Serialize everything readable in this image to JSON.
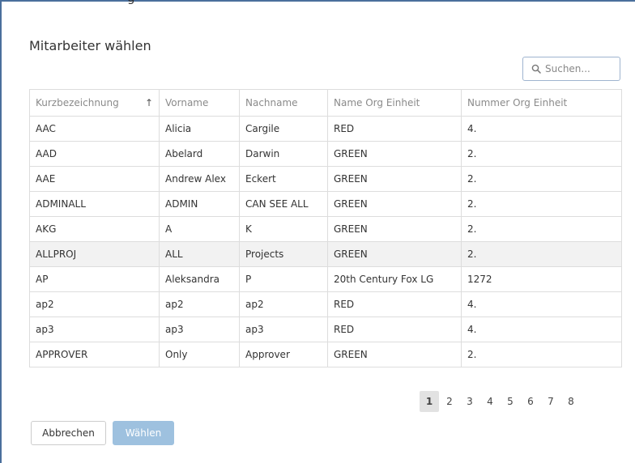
{
  "header": {
    "fragment": "g"
  },
  "dialog": {
    "title": "Mitarbeiter wählen",
    "search": {
      "placeholder": "Suchen...",
      "value": ""
    },
    "columns": [
      "Kurzbezeichnung",
      "Vorname",
      "Nachname",
      "Name Org Einheit",
      "Nummer Org Einheit"
    ],
    "sort_indicator": "↑",
    "rows": [
      [
        "AAC",
        "Alicia",
        "Cargile",
        "RED",
        "4."
      ],
      [
        "AAD",
        "Abelard",
        "Darwin",
        "GREEN",
        "2."
      ],
      [
        "AAE",
        "Andrew Alex",
        "Eckert",
        "GREEN",
        "2."
      ],
      [
        "ADMINALL",
        "ADMIN",
        "CAN SEE ALL",
        "GREEN",
        "2."
      ],
      [
        "AKG",
        "A",
        "K",
        "GREEN",
        "2."
      ],
      [
        "ALLPROJ",
        "ALL",
        "Projects",
        "GREEN",
        "2."
      ],
      [
        "AP",
        "Aleksandra",
        "P",
        "20th Century Fox LG",
        "1272"
      ],
      [
        "ap2",
        "ap2",
        "ap2",
        "RED",
        "4."
      ],
      [
        "ap3",
        "ap3",
        "ap3",
        "RED",
        "4."
      ],
      [
        "APPROVER",
        "Only",
        "Approver",
        "GREEN",
        "2."
      ]
    ],
    "highlighted_row": 5,
    "pagination": {
      "pages": [
        "1",
        "2",
        "3",
        "4",
        "5",
        "6",
        "7",
        "8"
      ],
      "current": "1"
    },
    "buttons": {
      "cancel": "Abbrechen",
      "choose": "Wählen"
    },
    "colors": {
      "frame": "#4a6f9c",
      "primary_disabled": "#9ec1df",
      "row_highlight": "#f2f2f2"
    }
  }
}
